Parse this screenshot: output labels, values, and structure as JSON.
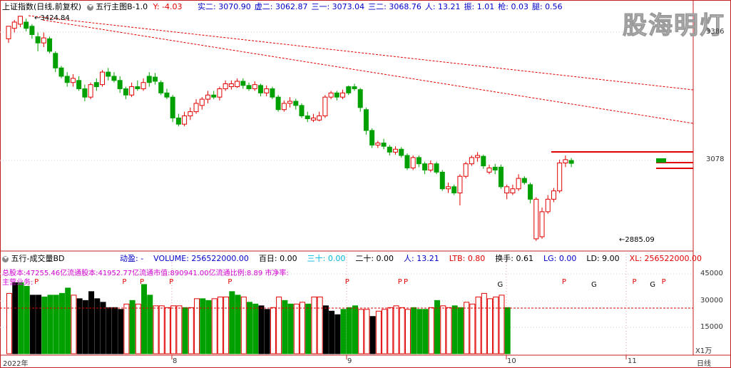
{
  "header": {
    "index_name": "上证指数(日线,前复权)",
    "indicator_name": "五行主图B-1.0",
    "y_value": "Y: -4.03",
    "values": [
      {
        "label": "实二:",
        "value": "3070.90",
        "color": "#0000c8"
      },
      {
        "label": "虚二:",
        "value": "3062.87",
        "color": "#0000c8"
      },
      {
        "label": "三一:",
        "value": "3073.04",
        "color": "#0000c8"
      },
      {
        "label": "三二:",
        "value": "3068.76",
        "color": "#0000c8"
      },
      {
        "label": "人:",
        "value": "13.21",
        "color": "#0000c8"
      },
      {
        "label": "振:",
        "value": "1.01",
        "color": "#0000c8"
      },
      {
        "label": "枪:",
        "value": "0.03",
        "color": "#0000c8"
      },
      {
        "label": "腿:",
        "value": "0.56",
        "color": "#0000c8"
      }
    ]
  },
  "brand": "股海明灯",
  "price_axis": {
    "labels": [
      "3386",
      "3078"
    ]
  },
  "annotations": {
    "high": "3424.84",
    "low": "2885.09"
  },
  "volume_panel": {
    "title": "五行-成交量BD",
    "items": [
      {
        "label": "动盈:",
        "value": "-",
        "color": "#0000c8"
      },
      {
        "label": "VOLUME:",
        "value": "256522000.00",
        "color": "#0000c8"
      },
      {
        "label": "百日:",
        "value": "0.00",
        "color": "#000000"
      },
      {
        "label": "三十:",
        "value": "0.00",
        "color": "#00b8d8"
      },
      {
        "label": "二十:",
        "value": "0.00",
        "color": "#000000"
      },
      {
        "label": "人:",
        "value": "13.21",
        "color": "#0000c8"
      },
      {
        "label": "LTB:",
        "value": "0.80",
        "color": "#e00000"
      },
      {
        "label": "换手:",
        "value": "0.61",
        "color": "#000000"
      },
      {
        "label": "LG:",
        "value": "0.00",
        "color": "#0000c8"
      },
      {
        "label": "LD:",
        "value": "9.00",
        "color": "#000000"
      },
      {
        "label": "XL:",
        "value": "256522000.00",
        "color": "#e00000"
      }
    ],
    "info_line": "总股本:47255.46亿流通股本:41952.77亿流通市值:890941.00亿流通比例:8.89   市净率:",
    "info_line2": "主营业务:",
    "axis_labels": [
      "45000",
      "30000",
      "15000"
    ],
    "unit": "X1万"
  },
  "x_axis": {
    "labels": [
      "2022年",
      "8",
      "9",
      "10",
      "11",
      "日线"
    ]
  },
  "chart_data": {
    "type": "candlestick",
    "period": "日线",
    "price_axis_ticks": [
      3386,
      3078
    ],
    "marked_high": 3424.84,
    "marked_low": 2885.09,
    "volume_axis_ticks": [
      45000,
      30000,
      15000
    ],
    "volume_unit": "X1万",
    "month_labels": [
      "2022年",
      "8",
      "9",
      "10",
      "11"
    ],
    "candles": [
      [
        3370,
        3400,
        3385,
        3360,
        "#e00000"
      ],
      [
        3395,
        3410,
        3415,
        3385,
        "#e00000"
      ],
      [
        3405,
        3424,
        3425,
        3398,
        "#e00000"
      ],
      [
        3410,
        3395,
        3418,
        3388,
        "#00a000"
      ],
      [
        3400,
        3380,
        3405,
        3370,
        "#00a000"
      ],
      [
        3375,
        3360,
        3385,
        3340,
        "#00a000"
      ],
      [
        3360,
        3372,
        3385,
        3350,
        "#e00000"
      ],
      [
        3370,
        3340,
        3375,
        3335,
        "#00a000"
      ],
      [
        3335,
        3300,
        3340,
        3290,
        "#00a000"
      ],
      [
        3300,
        3280,
        3305,
        3275,
        "#00a000"
      ],
      [
        3280,
        3265,
        3290,
        3255,
        "#00a000"
      ],
      [
        3265,
        3275,
        3285,
        3255,
        "#e00000"
      ],
      [
        3270,
        3250,
        3280,
        3245,
        "#00a000"
      ],
      [
        3250,
        3230,
        3260,
        3220,
        "#00a000"
      ],
      [
        3230,
        3260,
        3265,
        3225,
        "#e00000"
      ],
      [
        3255,
        3265,
        3275,
        3245,
        "#00a000"
      ],
      [
        3260,
        3290,
        3295,
        3255,
        "#e00000"
      ],
      [
        3290,
        3280,
        3300,
        3270,
        "#00a000"
      ],
      [
        3280,
        3270,
        3290,
        3265,
        "#00a000"
      ],
      [
        3270,
        3250,
        3280,
        3240,
        "#00a000"
      ],
      [
        3250,
        3235,
        3255,
        3225,
        "#00a000"
      ],
      [
        3235,
        3255,
        3265,
        3230,
        "#e00000"
      ],
      [
        3255,
        3250,
        3270,
        3245,
        "#00a000"
      ],
      [
        3250,
        3265,
        3275,
        3245,
        "#e00000"
      ],
      [
        3265,
        3280,
        3290,
        3255,
        "#00a000"
      ],
      [
        3278,
        3268,
        3288,
        3260,
        "#00a000"
      ],
      [
        3265,
        3240,
        3270,
        3235,
        "#00a000"
      ],
      [
        3240,
        3230,
        3250,
        3225,
        "#00a000"
      ],
      [
        3230,
        3180,
        3235,
        3170,
        "#00a000"
      ],
      [
        3180,
        3165,
        3190,
        3160,
        "#00a000"
      ],
      [
        3165,
        3185,
        3195,
        3160,
        "#e00000"
      ],
      [
        3185,
        3195,
        3205,
        3175,
        "#e00000"
      ],
      [
        3195,
        3215,
        3225,
        3190,
        "#e00000"
      ],
      [
        3210,
        3225,
        3230,
        3200,
        "#e00000"
      ],
      [
        3225,
        3235,
        3245,
        3215,
        "#e00000"
      ],
      [
        3235,
        3230,
        3245,
        3225,
        "#00a000"
      ],
      [
        3230,
        3250,
        3255,
        3222,
        "#e00000"
      ],
      [
        3250,
        3262,
        3270,
        3245,
        "#e00000"
      ],
      [
        3262,
        3255,
        3270,
        3248,
        "#e00000"
      ],
      [
        3255,
        3268,
        3275,
        3252,
        "#e00000"
      ],
      [
        3268,
        3258,
        3275,
        3250,
        "#00a000"
      ],
      [
        3258,
        3250,
        3265,
        3245,
        "#00a000"
      ],
      [
        3250,
        3260,
        3268,
        3245,
        "#e00000"
      ],
      [
        3258,
        3240,
        3262,
        3232,
        "#00a000"
      ],
      [
        3240,
        3250,
        3258,
        3232,
        "#e00000"
      ],
      [
        3250,
        3230,
        3255,
        3225,
        "#00a000"
      ],
      [
        3230,
        3200,
        3235,
        3195,
        "#00a000"
      ],
      [
        3200,
        3215,
        3222,
        3195,
        "#e00000"
      ],
      [
        3215,
        3220,
        3230,
        3205,
        "#e00000"
      ],
      [
        3220,
        3210,
        3226,
        3200,
        "#00a000"
      ],
      [
        3210,
        3185,
        3215,
        3180,
        "#00a000"
      ],
      [
        3185,
        3178,
        3195,
        3170,
        "#00a000"
      ],
      [
        3180,
        3175,
        3190,
        3170,
        "#e00000"
      ],
      [
        3175,
        3185,
        3195,
        3172,
        "#e00000"
      ],
      [
        3185,
        3230,
        3235,
        3180,
        "#e00000"
      ],
      [
        3230,
        3240,
        3245,
        3225,
        "#e00000"
      ],
      [
        3240,
        3230,
        3245,
        3222,
        "#00a000"
      ],
      [
        3230,
        3240,
        3248,
        3225,
        "#e00000"
      ],
      [
        3240,
        3255,
        3258,
        3235,
        "#00a000"
      ],
      [
        3255,
        3250,
        3262,
        3245,
        "#00a000"
      ],
      [
        3248,
        3205,
        3252,
        3195,
        "#00a000"
      ],
      [
        3200,
        3150,
        3205,
        3140,
        "#00a000"
      ],
      [
        3150,
        3115,
        3155,
        3108,
        "#00a000"
      ],
      [
        3115,
        3120,
        3125,
        3108,
        "#e00000"
      ],
      [
        3120,
        3112,
        3130,
        3105,
        "#00a000"
      ],
      [
        3110,
        3098,
        3115,
        3090,
        "#00a000"
      ],
      [
        3098,
        3105,
        3112,
        3092,
        "#e00000"
      ],
      [
        3105,
        3090,
        3110,
        3085,
        "#00a000"
      ],
      [
        3090,
        3060,
        3095,
        3055,
        "#00a000"
      ],
      [
        3060,
        3085,
        3090,
        3055,
        "#e00000"
      ],
      [
        3085,
        3070,
        3090,
        3062,
        "#00a000"
      ],
      [
        3070,
        3055,
        3075,
        3045,
        "#00a000"
      ],
      [
        3055,
        3070,
        3078,
        3050,
        "#e00000"
      ],
      [
        3070,
        3050,
        3075,
        3045,
        "#00a000"
      ],
      [
        3050,
        3010,
        3055,
        3005,
        "#00a000"
      ],
      [
        3010,
        3015,
        3025,
        3000,
        "#e00000"
      ],
      [
        3015,
        3000,
        3020,
        2995,
        "#00a000"
      ],
      [
        3000,
        3040,
        3045,
        2970,
        "#e00000"
      ],
      [
        3040,
        3070,
        3075,
        3035,
        "#e00000"
      ],
      [
        3070,
        3085,
        3090,
        3065,
        "#e00000"
      ],
      [
        3085,
        3090,
        3098,
        3075,
        "#e00000"
      ],
      [
        3088,
        3065,
        3092,
        3058,
        "#00a000"
      ],
      [
        3060,
        3050,
        3068,
        3045,
        "#e00000"
      ],
      [
        3055,
        3062,
        3070,
        3045,
        "#00a000"
      ],
      [
        3062,
        3015,
        3068,
        3010,
        "#00a000"
      ],
      [
        3015,
        3000,
        3020,
        2985,
        "#e00000"
      ],
      [
        3000,
        3010,
        3020,
        2995,
        "#e00000"
      ],
      [
        3010,
        3035,
        3045,
        3005,
        "#e00000"
      ],
      [
        3035,
        3025,
        3040,
        3020,
        "#00a000"
      ],
      [
        3020,
        2985,
        3025,
        2975,
        "#00a000"
      ],
      [
        2985,
        2890,
        2990,
        2885,
        "#e00000"
      ],
      [
        2895,
        2955,
        2965,
        2890,
        "#e00000"
      ],
      [
        2955,
        2985,
        2995,
        2950,
        "#e00000"
      ],
      [
        2985,
        3005,
        3012,
        2978,
        "#e00000"
      ],
      [
        3005,
        3072,
        3080,
        3000,
        "#e00000"
      ],
      [
        3072,
        3080,
        3090,
        3062,
        "#e00000"
      ],
      [
        3078,
        3071,
        3084,
        3062,
        "#00a000"
      ]
    ],
    "volumes": [
      [
        34000,
        "#e00000"
      ],
      [
        40000,
        "#000000"
      ],
      [
        40000,
        "#00a000"
      ],
      [
        38000,
        "#00a000"
      ],
      [
        33000,
        "#000000"
      ],
      [
        33000,
        "#000000"
      ],
      [
        32000,
        "#00a000"
      ],
      [
        33000,
        "#00a000"
      ],
      [
        33000,
        "#00a000"
      ],
      [
        34000,
        "#00a000"
      ],
      [
        37000,
        "#00a000"
      ],
      [
        33000,
        "#e00000"
      ],
      [
        31000,
        "#000000"
      ],
      [
        30000,
        "#000000"
      ],
      [
        35000,
        "#000000"
      ],
      [
        31000,
        "#000000"
      ],
      [
        29000,
        "#000000"
      ],
      [
        26000,
        "#000000"
      ],
      [
        26000,
        "#000000"
      ],
      [
        25000,
        "#000000"
      ],
      [
        28000,
        "#e00000"
      ],
      [
        30000,
        "#00a000"
      ],
      [
        28000,
        "#e00000"
      ],
      [
        39000,
        "#00a000"
      ],
      [
        33000,
        "#00a000"
      ],
      [
        27000,
        "#e00000"
      ],
      [
        27000,
        "#e00000"
      ],
      [
        26000,
        "#e00000"
      ],
      [
        27000,
        "#e00000"
      ],
      [
        27000,
        "#e00000"
      ],
      [
        26000,
        "#00a000"
      ],
      [
        26000,
        "#e00000"
      ],
      [
        31000,
        "#e00000"
      ],
      [
        31000,
        "#00a000"
      ],
      [
        30000,
        "#00a000"
      ],
      [
        31000,
        "#e00000"
      ],
      [
        32000,
        "#e00000"
      ],
      [
        32000,
        "#e00000"
      ],
      [
        35000,
        "#00a000"
      ],
      [
        33000,
        "#00a000"
      ],
      [
        32000,
        "#e00000"
      ],
      [
        29000,
        "#00a000"
      ],
      [
        28000,
        "#00a000"
      ],
      [
        27000,
        "#000000"
      ],
      [
        25000,
        "#000000"
      ],
      [
        26000,
        "#e00000"
      ],
      [
        32000,
        "#e00000"
      ],
      [
        30000,
        "#00a000"
      ],
      [
        28000,
        "#00a000"
      ],
      [
        28000,
        "#e00000"
      ],
      [
        29000,
        "#e00000"
      ],
      [
        28000,
        "#00a000"
      ],
      [
        32000,
        "#e00000"
      ],
      [
        32000,
        "#e00000"
      ],
      [
        27000,
        "#000000"
      ],
      [
        24000,
        "#000000"
      ],
      [
        22000,
        "#000000"
      ],
      [
        25000,
        "#00a000"
      ],
      [
        26000,
        "#00a000"
      ],
      [
        27000,
        "#00a000"
      ],
      [
        25000,
        "#e00000"
      ],
      [
        25000,
        "#e00000"
      ],
      [
        21000,
        "#000000"
      ],
      [
        24000,
        "#e00000"
      ],
      [
        25000,
        "#e00000"
      ],
      [
        26000,
        "#e00000"
      ],
      [
        27000,
        "#e00000"
      ],
      [
        26000,
        "#e00000"
      ],
      [
        25000,
        "#e00000"
      ],
      [
        26000,
        "#00a000"
      ],
      [
        25000,
        "#00a000"
      ],
      [
        25000,
        "#00a000"
      ],
      [
        26000,
        "#e00000"
      ],
      [
        30000,
        "#00a000"
      ],
      [
        27000,
        "#e00000"
      ],
      [
        26000,
        "#e00000"
      ],
      [
        27000,
        "#00a000"
      ],
      [
        26000,
        "#00a000"
      ],
      [
        29000,
        "#e00000"
      ],
      [
        28000,
        "#e00000"
      ],
      [
        32000,
        "#e00000"
      ],
      [
        34000,
        "#e00000"
      ],
      [
        31000,
        "#e00000"
      ],
      [
        32000,
        "#e00000"
      ],
      [
        33000,
        "#e00000"
      ],
      [
        26000,
        "#00a000"
      ]
    ],
    "signal_marks": [
      {
        "label": "P",
        "index": 5
      },
      {
        "label": "P",
        "index": 20
      },
      {
        "label": "P",
        "index": 23
      },
      {
        "label": "P",
        "index": 28
      },
      {
        "label": "P",
        "index": 38
      },
      {
        "label": "P",
        "index": 58
      },
      {
        "label": "P",
        "index": 67
      },
      {
        "label": "P",
        "index": 68
      },
      {
        "label": "G",
        "index": 84
      },
      {
        "label": "P",
        "index": 95
      },
      {
        "label": "G",
        "index": 100
      },
      {
        "label": "P",
        "index": 107
      },
      {
        "label": "G",
        "index": 110
      },
      {
        "label": "P",
        "index": 112
      }
    ],
    "colors": {
      "up": "#e00000",
      "down": "#00a000",
      "black": "#000000",
      "trend": "#e00000"
    }
  }
}
